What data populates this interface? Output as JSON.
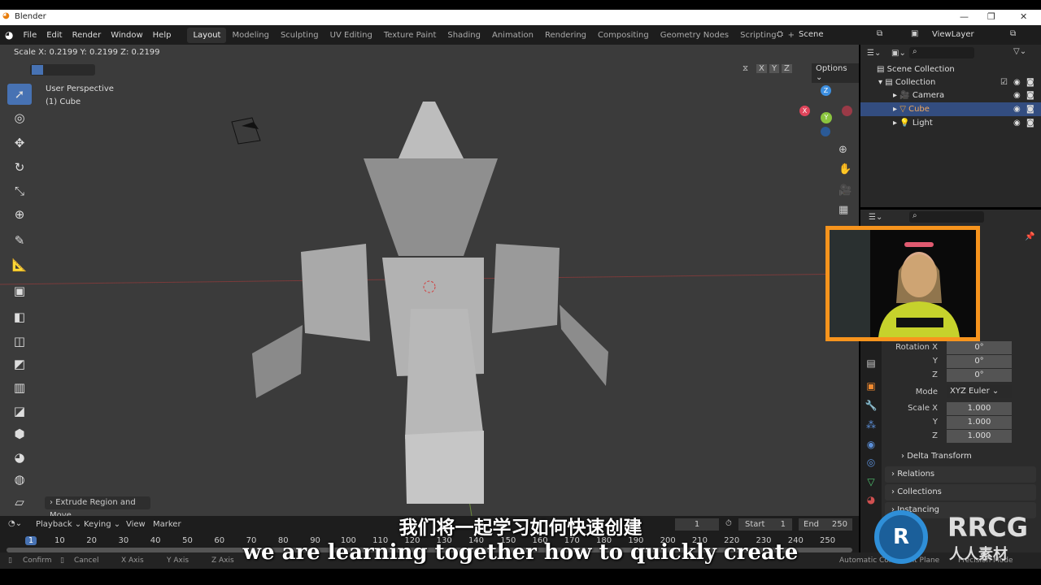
{
  "window": {
    "title": "Blender"
  },
  "menu": [
    "File",
    "Edit",
    "Render",
    "Window",
    "Help"
  ],
  "workspaces": [
    "Layout",
    "Modeling",
    "Sculpting",
    "UV Editing",
    "Texture Paint",
    "Shading",
    "Animation",
    "Rendering",
    "Compositing",
    "Geometry Nodes",
    "Scripting",
    "+"
  ],
  "scene": {
    "label": "Scene",
    "view_layer": "ViewLayer"
  },
  "header": {
    "operator_status": "Scale X: 0.2199   Y: 0.2199   Z: 0.2199",
    "axes": [
      "X",
      "Y",
      "Z"
    ],
    "options": "Options"
  },
  "viewport": {
    "view_name": "User Perspective",
    "object": "(1) Cube",
    "last_op": "Extrude Region and Move",
    "gizmo": {
      "x": "X",
      "y": "Y",
      "z": "Z"
    }
  },
  "outliner": {
    "root": "Scene Collection",
    "collection": "Collection",
    "items": [
      {
        "name": "Camera",
        "selected": false
      },
      {
        "name": "Cube",
        "selected": true
      },
      {
        "name": "Light",
        "selected": false
      }
    ]
  },
  "properties": {
    "rotation": {
      "label": "Rotation X",
      "y": "Y",
      "z": "Z",
      "values": [
        "0°",
        "0°",
        "0°"
      ]
    },
    "mode": {
      "label": "Mode",
      "value": "XYZ Euler"
    },
    "scale": {
      "label": "Scale X",
      "y": "Y",
      "z": "Z",
      "values": [
        "1.000",
        "1.000",
        "1.000"
      ]
    },
    "panels": [
      "Delta Transform",
      "Relations",
      "Collections",
      "Instancing"
    ]
  },
  "timeline": {
    "menus": [
      "Playback",
      "Keying",
      "View",
      "Marker"
    ],
    "current_frame": "1",
    "start_label": "Start",
    "start": "1",
    "end_label": "End",
    "end": "250",
    "ticks": [
      "1",
      "10",
      "20",
      "30",
      "40",
      "50",
      "60",
      "70",
      "80",
      "90",
      "100",
      "110",
      "120",
      "130",
      "140",
      "150",
      "160",
      "170",
      "180",
      "190",
      "200",
      "210",
      "220",
      "230",
      "240",
      "250"
    ]
  },
  "status": {
    "items": [
      "Confirm",
      "Cancel",
      "X Axis",
      "Y Axis",
      "Z Axis"
    ],
    "right": [
      "Automatic Constraint Plane",
      "Precision Mode"
    ]
  },
  "subtitles": {
    "zh": "我们将一起学习如何快速创建",
    "en": "we are learning together how to quickly create"
  },
  "watermark": "RRCG 人人素材",
  "colors": {
    "accent": "#4772b3",
    "webcam_border": "#f7941d",
    "x_axis": "#e0455b",
    "y_axis": "#8bc53f",
    "z_axis": "#3d8fe0"
  }
}
